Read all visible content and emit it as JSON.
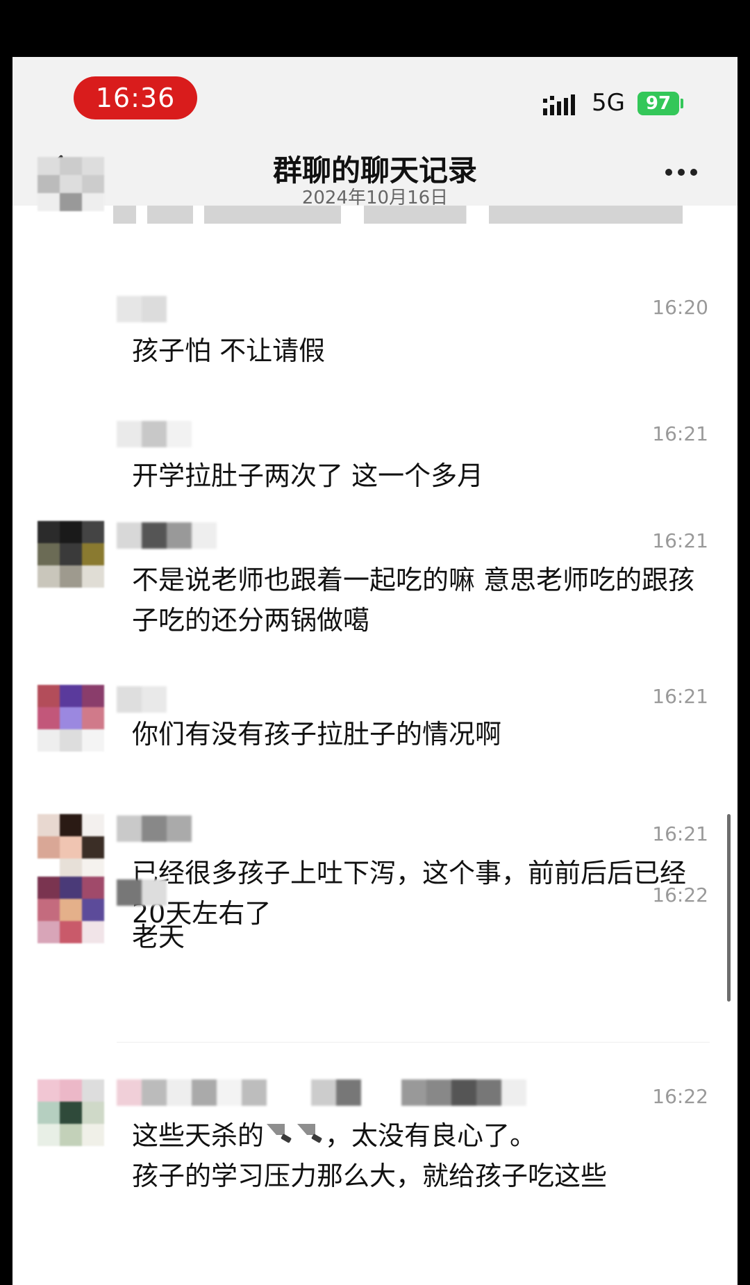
{
  "status_bar": {
    "time": "16:36",
    "network": "5G",
    "battery": "97"
  },
  "header": {
    "title": "群聊的聊天记录",
    "date": "2024年10月16日"
  },
  "messages": [
    {
      "time": "16:20",
      "text": "孩子怕  不让请假"
    },
    {
      "time": "16:21",
      "text": "开学拉肚子两次了    这一个多月"
    },
    {
      "time": "16:21",
      "text": "不是说老师也跟着一起吃的嘛 意思老师吃的跟孩子吃的还分两锅做噶"
    },
    {
      "time": "16:21",
      "text": "你们有没有孩子拉肚子的情况啊"
    },
    {
      "time": "16:21",
      "text": "已经很多孩子上吐下泻，这个事，前前后后已经20天左右了"
    },
    {
      "time": "16:22",
      "text": "老天"
    },
    {
      "time": "16:22",
      "text_a": "这些天杀的",
      "text_b": "，太没有良心了。",
      "text_c": "孩子的学习压力那么大，就给孩子吃这些"
    }
  ],
  "icons": {
    "back": "chevron-left-icon",
    "more": "more-dots-icon",
    "signal": "signal-icon",
    "emoji": "kitchen-knife-icon"
  },
  "colors": {
    "time_pill": "#d91c1c",
    "battery": "#34c759",
    "header_bg": "#f2f2f2"
  }
}
